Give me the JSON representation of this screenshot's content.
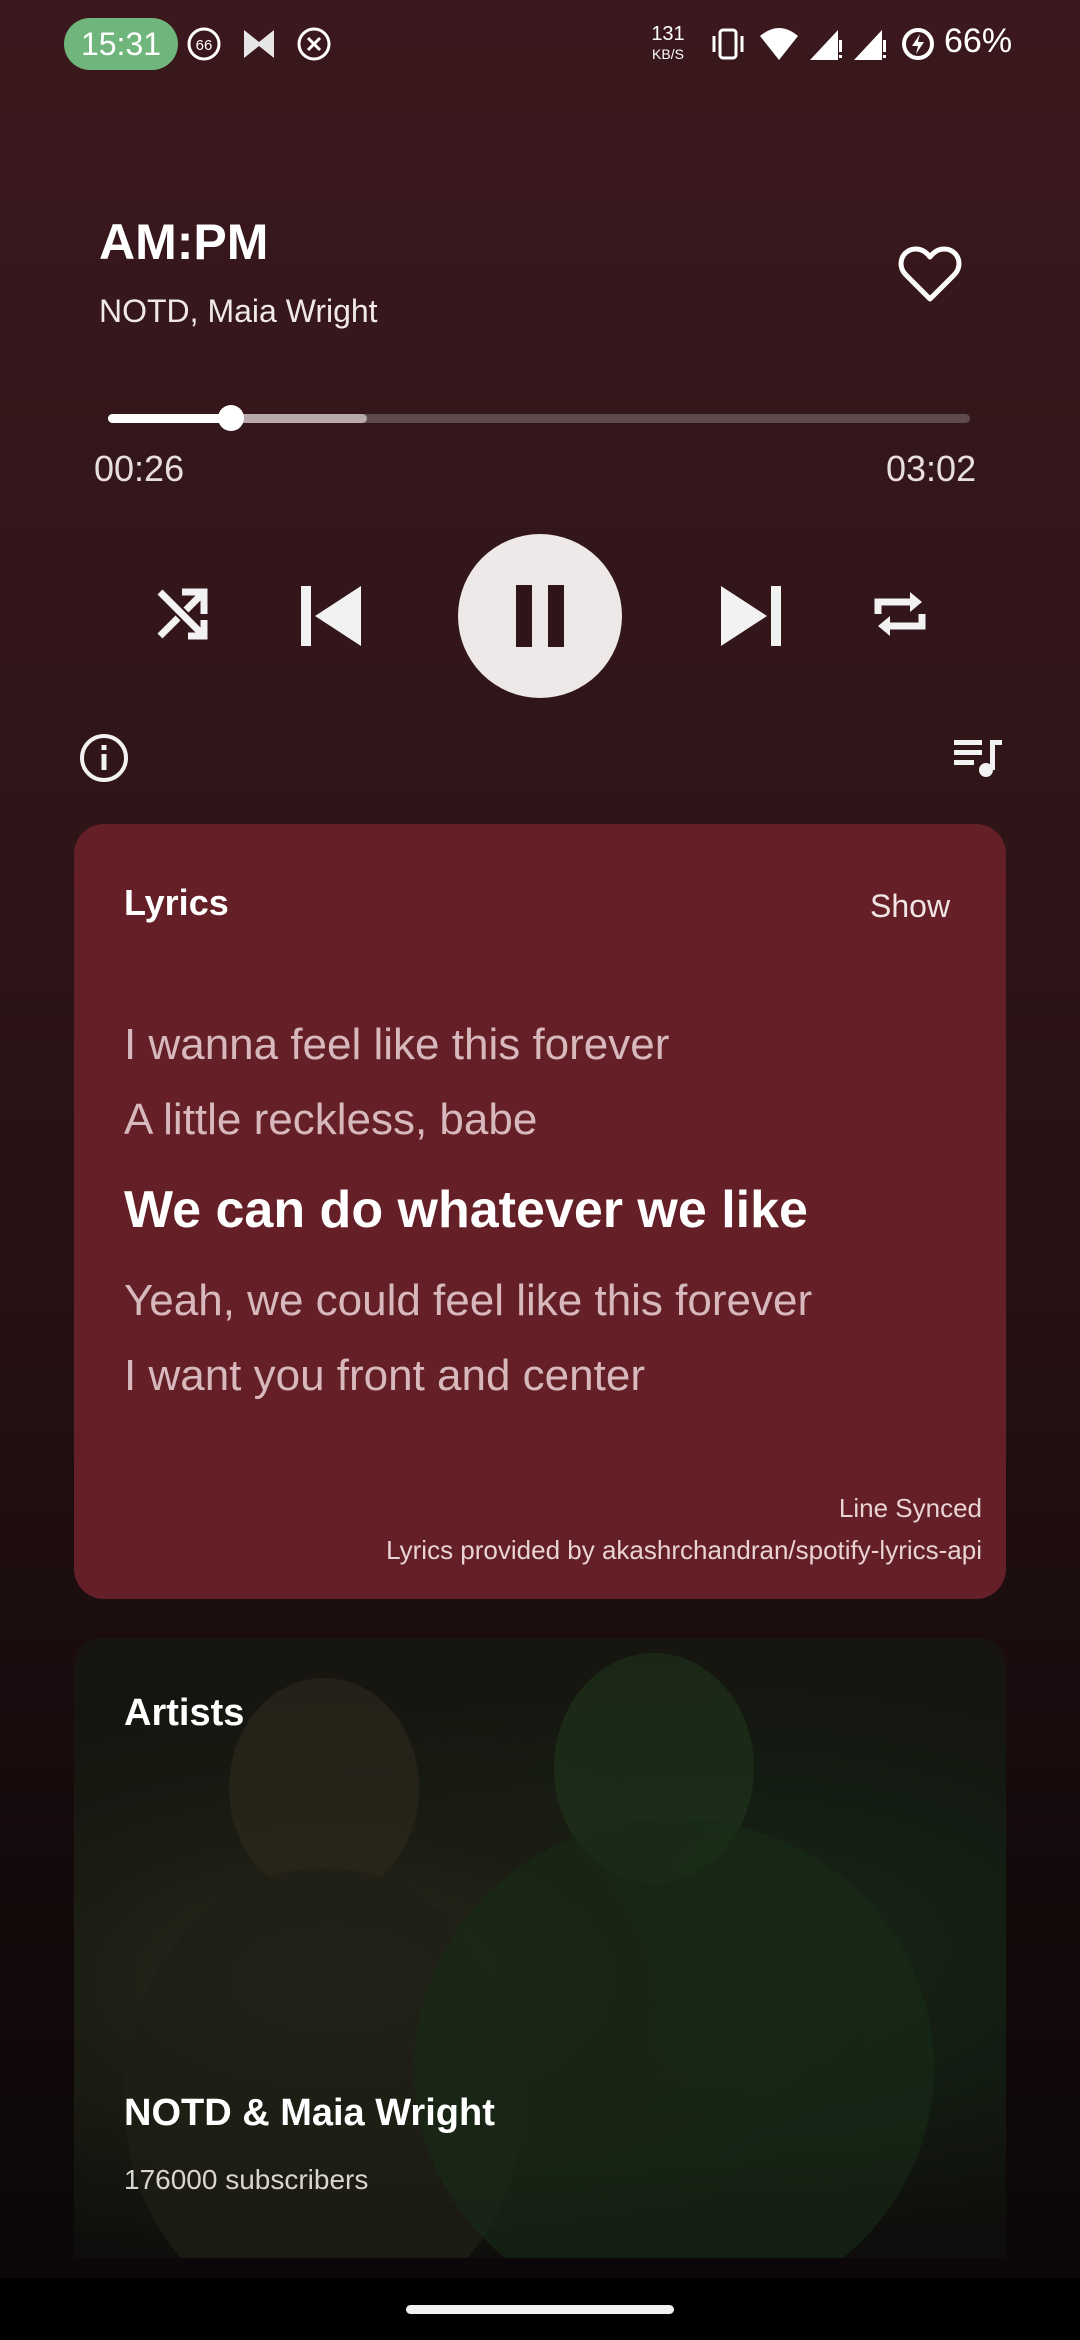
{
  "status_bar": {
    "time": "15:31",
    "notif_badge": "66",
    "speed_value": "131",
    "speed_unit": "KB/S",
    "battery": "66%",
    "icons": [
      "badge-66-icon",
      "butterfly-icon",
      "x-circle-icon",
      "vibrate-icon",
      "wifi-icon",
      "signal-icon",
      "signal-icon-2",
      "battery-saver-icon"
    ]
  },
  "now_playing": {
    "title": "AM:PM",
    "artist": "NOTD, Maia Wright",
    "liked_icon": "heart-outline-icon"
  },
  "progress": {
    "current": "00:26",
    "total": "03:02",
    "played_fraction": 0.143,
    "buffered_fraction": 0.3
  },
  "controls": {
    "shuffle_icon": "shuffle-icon",
    "previous_icon": "skip-previous-icon",
    "play_pause_icon": "pause-icon",
    "next_icon": "skip-next-icon",
    "repeat_icon": "repeat-icon",
    "info_icon": "info-icon",
    "queue_icon": "queue-music-icon"
  },
  "lyrics": {
    "title": "Lyrics",
    "show_label": "Show",
    "lines": [
      "I wanna feel like this forever",
      "A little reckless, babe",
      "We can do whatever we like",
      "Yeah, we could feel like this forever",
      "I want you front and center"
    ],
    "active_line_index": 2,
    "sync_type": "Line Synced",
    "provided_by": "Lyrics provided by akashrchandran/spotify-lyrics-api"
  },
  "artists": {
    "title": "Artists",
    "name": "NOTD & Maia Wright",
    "subscribers": "176000 subscribers"
  },
  "colors": {
    "accent_card": "#641f27",
    "time_pill": "#6fb57c",
    "background_top": "#3a181d"
  }
}
